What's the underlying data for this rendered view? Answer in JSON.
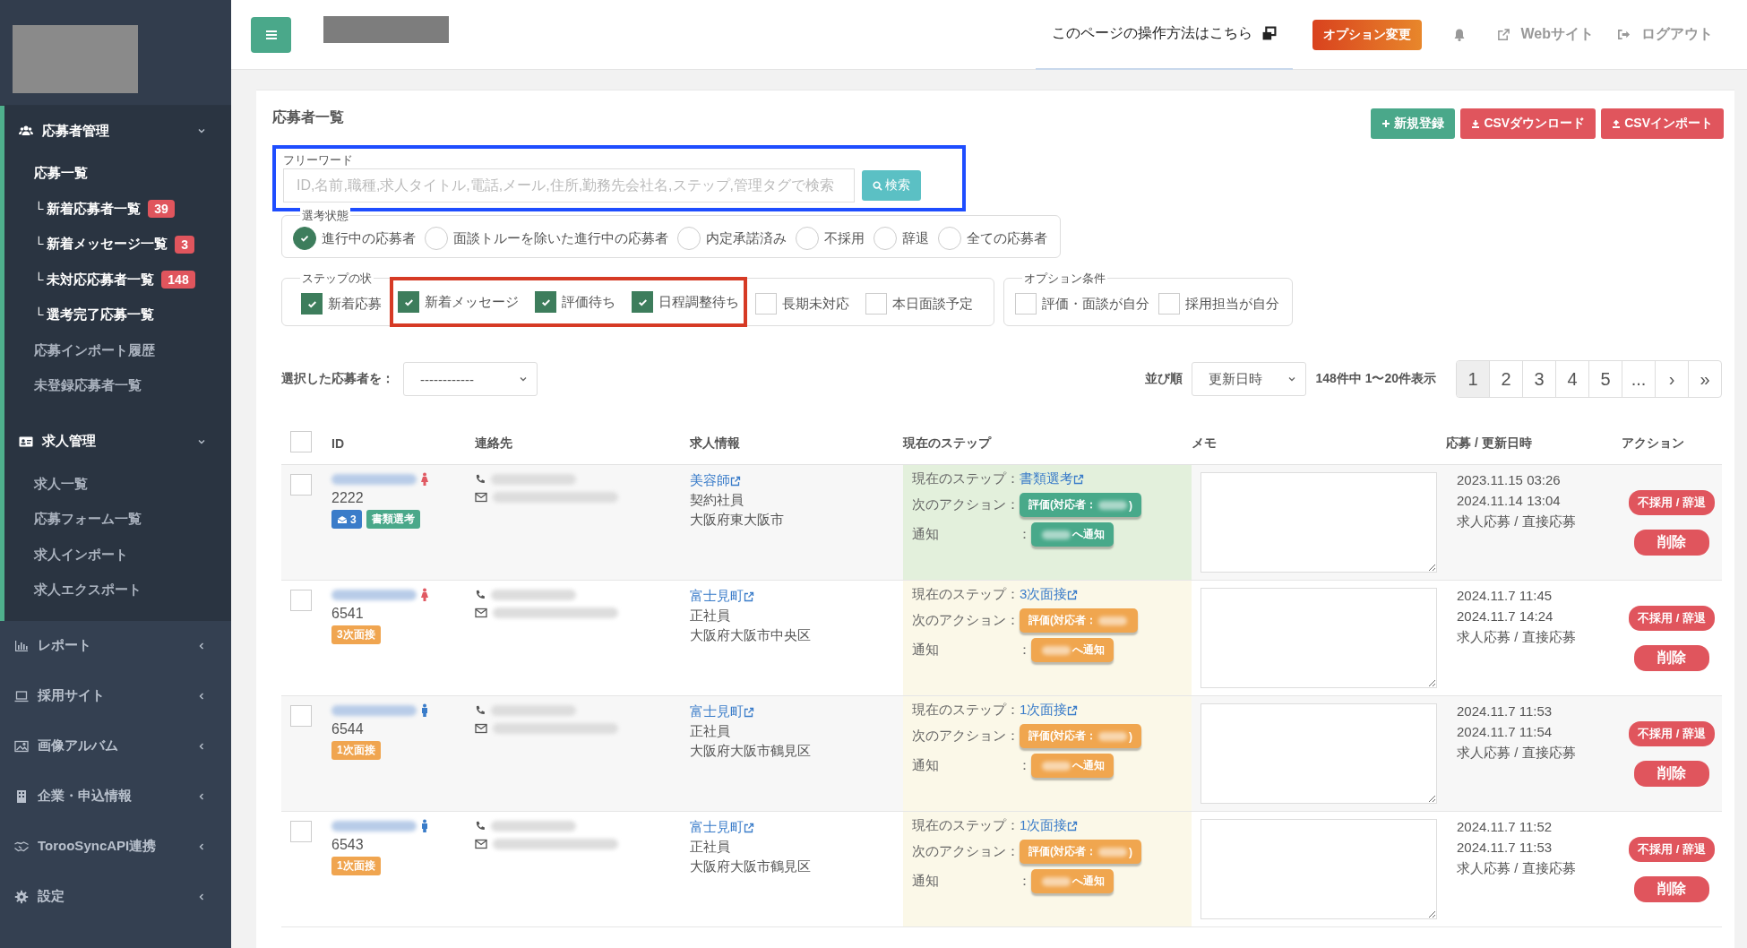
{
  "sidebar": {
    "sections": [
      {
        "label": "応募者管理",
        "expanded": true,
        "items": [
          {
            "label": "応募一覧",
            "highlighted": true
          },
          {
            "label": "└ 新着応募者一覧",
            "highlighted": true,
            "badge": "39"
          },
          {
            "label": "└ 新着メッセージ一覧",
            "highlighted": true,
            "badge": "3"
          },
          {
            "label": "└ 未対応応募者一覧",
            "highlighted": true,
            "badge": "148"
          },
          {
            "label": "└ 選考完了応募一覧",
            "highlighted": true
          },
          {
            "label": "応募インポート履歴",
            "highlighted": false
          },
          {
            "label": "未登録応募者一覧",
            "highlighted": false
          }
        ]
      },
      {
        "label": "求人管理",
        "expanded": true,
        "items": [
          {
            "label": "求人一覧",
            "highlighted": false
          },
          {
            "label": "応募フォーム一覧",
            "highlighted": false
          },
          {
            "label": "求人インポート",
            "highlighted": false
          },
          {
            "label": "求人エクスポート",
            "highlighted": false
          }
        ]
      },
      {
        "label": "レポート",
        "expanded": false
      },
      {
        "label": "採用サイト",
        "expanded": false
      },
      {
        "label": "画像アルバム",
        "expanded": false
      },
      {
        "label": "企業・申込情報",
        "expanded": false
      },
      {
        "label": "TorooSyncAPI連携",
        "expanded": false
      },
      {
        "label": "設定",
        "expanded": false
      }
    ]
  },
  "header": {
    "help_link": "このページの操作方法はこちら",
    "option_button": "オプション変更",
    "website_link": "Webサイト",
    "logout_link": "ログアウト"
  },
  "page": {
    "title": "応募者一覧",
    "buttons": [
      {
        "label": "新規登録",
        "kind": "add"
      },
      {
        "label": "CSVダウンロード",
        "kind": "download"
      },
      {
        "label": "CSVインポート",
        "kind": "import"
      }
    ]
  },
  "search": {
    "legend": "フリーワード",
    "placeholder": "ID,名前,職種,求人タイトル,電話,メール,住所,勤務先会社名,ステップ,管理タグで検索",
    "button": "検索",
    "annotated": true
  },
  "selection_status": {
    "legend": "選考状態",
    "options": [
      {
        "label": "進行中の応募者",
        "selected": true
      },
      {
        "label": "面談トルーを除いた進行中の応募者",
        "selected": false
      },
      {
        "label": "内定承諾済み",
        "selected": false
      },
      {
        "label": "不採用",
        "selected": false
      },
      {
        "label": "辞退",
        "selected": false
      },
      {
        "label": "全ての応募者",
        "selected": false
      }
    ]
  },
  "step_status": {
    "legend": "ステップの状",
    "options": [
      {
        "label": "新着応募",
        "checked": true,
        "annotated": false
      },
      {
        "label": "新着メッセージ",
        "checked": true,
        "annotated": true
      },
      {
        "label": "評価待ち",
        "checked": true,
        "annotated": true
      },
      {
        "label": "日程調整待ち",
        "checked": true,
        "annotated": true
      },
      {
        "label": "長期未対応",
        "checked": false,
        "annotated": false
      },
      {
        "label": "本日面談予定",
        "checked": false,
        "annotated": false
      }
    ]
  },
  "option_conditions": {
    "legend": "オプション条件",
    "options": [
      {
        "label": "評価・面談が自分",
        "checked": false
      },
      {
        "label": "採用担当が自分",
        "checked": false
      }
    ]
  },
  "bulk": {
    "label": "選択した応募者を：",
    "value": "------------"
  },
  "sort": {
    "label": "並び順",
    "value": "更新日時"
  },
  "count": "148件中 1〜20件表示",
  "pagination": [
    {
      "label": "1",
      "selected": true
    },
    {
      "label": "2",
      "selected": false
    },
    {
      "label": "3",
      "selected": false
    },
    {
      "label": "4",
      "selected": false
    },
    {
      "label": "5",
      "selected": false
    },
    {
      "label": "...",
      "selected": false
    },
    {
      "label": "›",
      "selected": false
    },
    {
      "label": "»",
      "selected": false
    }
  ],
  "table": {
    "header_checked": false,
    "columns": [
      "ID",
      "連絡先",
      "求人情報",
      "現在のステップ",
      "メモ",
      "応募 / 更新日時",
      "アクション"
    ],
    "rows": [
      {
        "checked": false,
        "person_icon": {
          "kind": "female",
          "color": "#e05a63"
        },
        "id": "2222",
        "tags": [
          {
            "kind": "message",
            "text": "3",
            "color": "#3a7cc9"
          },
          {
            "kind": "label",
            "text": "書類選考",
            "color": "#4aa88a"
          }
        ],
        "job": {
          "title": "美容師",
          "type": "契約社員",
          "location": "大阪府東大阪市"
        },
        "step": {
          "kind": "screening",
          "label": "現在のステップ：",
          "value": "書類選考",
          "next_label": "次のアクション：",
          "action": "評価(対応者：",
          "action_close": ")",
          "notify_label": "通知",
          "notify_colon": "：",
          "notify": "へ通知"
        },
        "dates": [
          "2023.11.15 03:26",
          "2024.11.14 13:04"
        ],
        "source": "求人応募 / 直接応募",
        "reject": "不採用 / 辞退",
        "delete": "削除"
      },
      {
        "checked": false,
        "person_icon": {
          "kind": "female",
          "color": "#e05a63"
        },
        "id": "6541",
        "tags": [
          {
            "kind": "label",
            "text": "3次面接",
            "color": "#f0a550"
          }
        ],
        "job": {
          "title": "富士見町",
          "type": "正社員",
          "location": "大阪府大阪市中央区"
        },
        "step": {
          "kind": "interview",
          "label": "現在のステップ：",
          "value": "3次面接",
          "next_label": "次のアクション：",
          "action": "評価(対応者：",
          "notify_label": "通知",
          "notify_colon": "：",
          "notify": "へ通知"
        },
        "dates": [
          "2024.11.7 11:45",
          "2024.11.7 14:24"
        ],
        "source": "求人応募 / 直接応募",
        "reject": "不採用 / 辞退",
        "delete": "削除"
      },
      {
        "checked": false,
        "person_icon": {
          "kind": "male",
          "color": "#3a7cc9"
        },
        "id": "6544",
        "tags": [
          {
            "kind": "label",
            "text": "1次面接",
            "color": "#f0a550"
          }
        ],
        "job": {
          "title": "富士見町",
          "type": "正社員",
          "location": "大阪府大阪市鶴見区"
        },
        "step": {
          "kind": "interview",
          "label": "現在のステップ：",
          "value": "1次面接",
          "next_label": "次のアクション：",
          "action": "評価(対応者：",
          "action_close": ")",
          "notify_label": "通知",
          "notify_colon": "：",
          "notify": "へ通知"
        },
        "dates": [
          "2024.11.7 11:53",
          "2024.11.7 11:54"
        ],
        "source": "求人応募 / 直接応募",
        "reject": "不採用 / 辞退",
        "delete": "削除"
      },
      {
        "checked": false,
        "person_icon": {
          "kind": "male",
          "color": "#3a7cc9"
        },
        "id": "6543",
        "tags": [
          {
            "kind": "label",
            "text": "1次面接",
            "color": "#f0a550"
          }
        ],
        "job": {
          "title": "富士見町",
          "type": "正社員",
          "location": "大阪府大阪市鶴見区"
        },
        "step": {
          "kind": "interview",
          "label": "現在のステップ：",
          "value": "1次面接",
          "next_label": "次のアクション：",
          "action": "評価(対応者：",
          "action_close": ")",
          "notify_label": "通知",
          "notify_colon": "：",
          "notify": "へ通知"
        },
        "dates": [
          "2024.11.7 11:52",
          "2024.11.7 11:53"
        ],
        "source": "求人応募 / 直接応募",
        "reject": "不採用 / 辞退",
        "delete": "削除"
      }
    ]
  }
}
